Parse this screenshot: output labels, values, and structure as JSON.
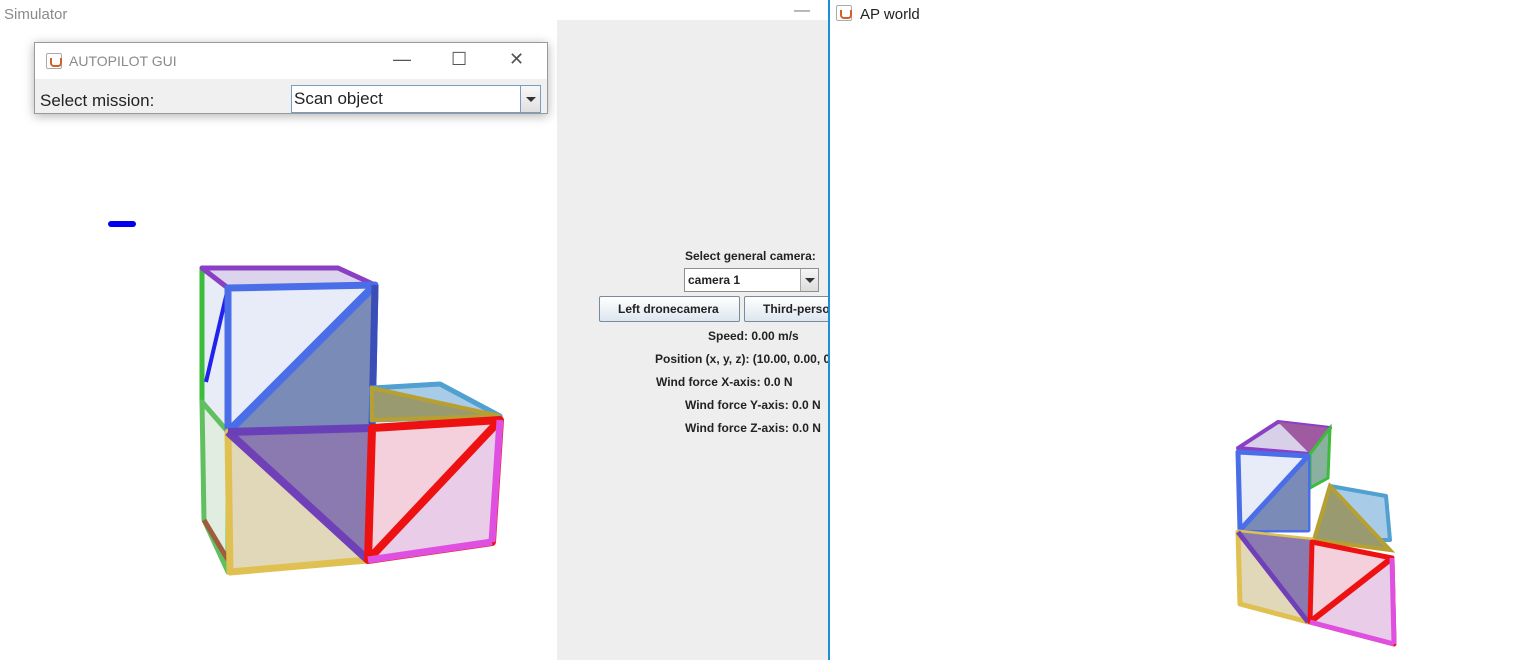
{
  "simulator": {
    "title": "Simulator",
    "minimize_glyph": "—",
    "viewport_marker_color": "#0000ee"
  },
  "autopilot_window": {
    "title": "AUTOPILOT GUI",
    "controls": {
      "minimize": "—",
      "maximize": "☐",
      "close": "✕"
    },
    "mission_label": "Select mission:",
    "mission_value": "Scan object"
  },
  "control_panel": {
    "camera_label": "Select general camera:",
    "camera_value": "camera 1",
    "left_camera_button": "Left dronecamera",
    "third_person_button": "Third-perso",
    "speed": "Speed: 0.00 m/s",
    "position": "Position (x, y, z): (10.00, 0.00, 0",
    "wind_x": "Wind force X-axis: 0.0 N",
    "wind_y": "Wind force Y-axis: 0.0 N",
    "wind_z": "Wind force Z-axis: 0.0 N"
  },
  "ap_world": {
    "title": "AP world",
    "border_color": "#1c8fd8"
  },
  "cube_colors": [
    "#4169e1",
    "#7b3fc4",
    "#ee1111",
    "#e050e0",
    "#e0c050",
    "#50c050",
    "#50a0d0",
    "#b0a030",
    "#a06040"
  ]
}
